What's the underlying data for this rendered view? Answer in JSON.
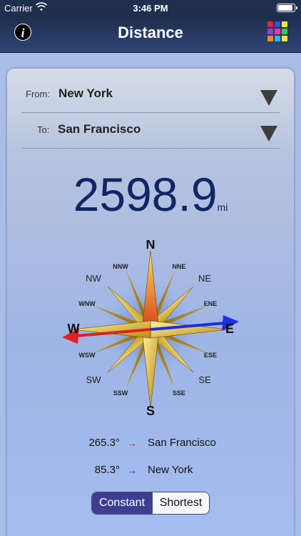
{
  "status_bar": {
    "carrier": "Carrier",
    "time": "3:46 PM"
  },
  "nav": {
    "title": "Distance",
    "info_icon": "info-icon",
    "grid_icon": "color-grid-icon"
  },
  "route": {
    "from_label": "From:",
    "from_value": "New York",
    "to_label": "To:",
    "to_value": "San Francisco"
  },
  "distance": {
    "value": "2598.9",
    "unit": "mi"
  },
  "compass": {
    "directions": {
      "N": "N",
      "NNE": "NNE",
      "NE": "NE",
      "ENE": "ENE",
      "E": "E",
      "ESE": "ESE",
      "SE": "SE",
      "SSE": "SSE",
      "S": "S",
      "SSW": "SSW",
      "SW": "SW",
      "WSW": "WSW",
      "W": "W",
      "WNW": "WNW",
      "NW": "NW",
      "NNW": "NNW"
    },
    "arrow_colors": {
      "red": "#e02020",
      "blue": "#1a2fe0"
    }
  },
  "bearings": [
    {
      "degrees": "265.3°",
      "arrow": "→",
      "arrow_color": "#e02020",
      "city": "San Francisco"
    },
    {
      "degrees": "85.3°",
      "arrow": "→",
      "arrow_color": "#1a2fe0",
      "city": "New York"
    }
  ],
  "mode": {
    "options": [
      "Constant",
      "Shortest"
    ],
    "selected": "Constant"
  }
}
